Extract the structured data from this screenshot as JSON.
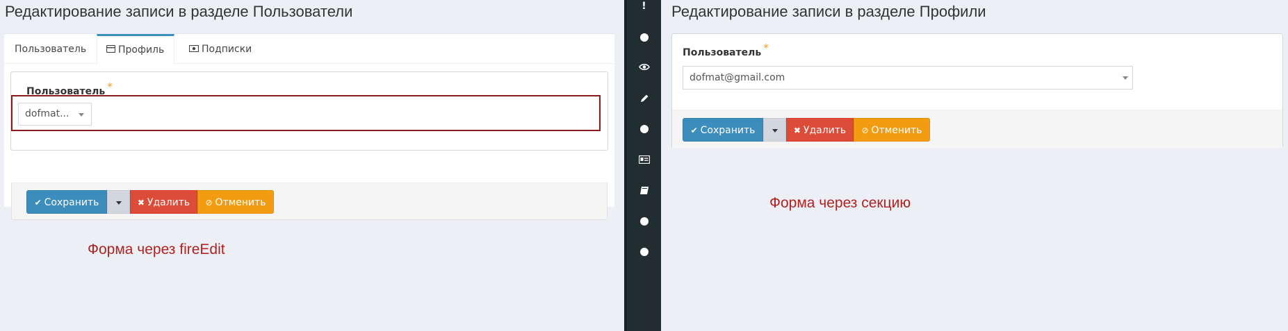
{
  "left": {
    "title": "Редактирование записи в разделе Пользователи",
    "tabs": [
      {
        "label": "Пользователь",
        "icon": ""
      },
      {
        "label": "Профиль",
        "icon": "id-card-icon"
      },
      {
        "label": "Подписки",
        "icon": "money-icon"
      }
    ],
    "field_label": "Пользователь",
    "required_mark": "*",
    "select_value": "dofmat...",
    "buttons": {
      "save": "Сохранить",
      "delete": "Удалить",
      "cancel": "Отменить"
    },
    "caption": "Форма через fireEdit"
  },
  "sidebar": {
    "icons": [
      "exclamation-icon",
      "circle-icon",
      "eye-icon",
      "pencil-icon",
      "circle-icon",
      "id-card-icon",
      "book-icon",
      "circle-icon",
      "circle-icon"
    ]
  },
  "right": {
    "title": "Редактирование записи в разделе Профили",
    "field_label": "Пользователь",
    "required_mark": "*",
    "select_value": "dofmat@gmail.com",
    "buttons": {
      "save": "Сохранить",
      "delete": "Удалить",
      "cancel": "Отменить"
    },
    "caption": "Форма через секцию"
  },
  "colors": {
    "primary": "#3c8dbc",
    "danger": "#dd4b39",
    "warning": "#f39c12",
    "caption_red": "#b22222",
    "sidebar_dark": "#222d32"
  }
}
